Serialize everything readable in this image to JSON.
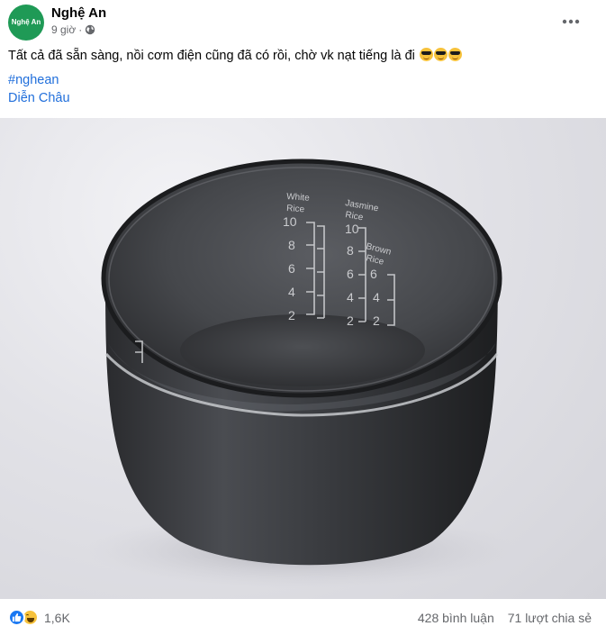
{
  "post": {
    "page_name": "Nghệ An",
    "avatar_text": "Nghệ An",
    "time": "9 giờ",
    "separator": "·",
    "privacy_icon": "globe-icon",
    "more_icon": "more-horizontal-icon",
    "text": "Tất cả đã sẵn sàng, nồi cơm điện cũng đã có rồi, chờ vk nạt tiếng là đi",
    "emoji_icons": [
      "smiling-face-with-sunglasses-icon",
      "smiling-face-with-sunglasses-icon",
      "smiling-face-with-sunglasses-icon"
    ],
    "hashtag": "#nghean",
    "location": "Diễn Châu"
  },
  "photo": {
    "marks": {
      "white_rice": [
        "White",
        "Rice"
      ],
      "jasmine_rice": [
        "Jasmine",
        "Rice"
      ],
      "brown_rice": [
        "Brown",
        "Rice"
      ],
      "white_levels": [
        "10",
        "8",
        "6",
        "4",
        "2"
      ],
      "jasmine_levels": [
        "10",
        "8",
        "6",
        "4",
        "2"
      ],
      "brown_levels": [
        "6",
        "4",
        "2"
      ]
    }
  },
  "footer": {
    "reaction_icons": [
      "like-icon",
      "haha-icon"
    ],
    "reaction_count": "1,6K",
    "comments": "428 bình luận",
    "shares": "71 lượt chia sẻ"
  },
  "colors": {
    "avatar_bg": "#1f9a56",
    "link": "#216fdb",
    "secondary_text": "#65676b",
    "like_blue": "#1877f2"
  }
}
